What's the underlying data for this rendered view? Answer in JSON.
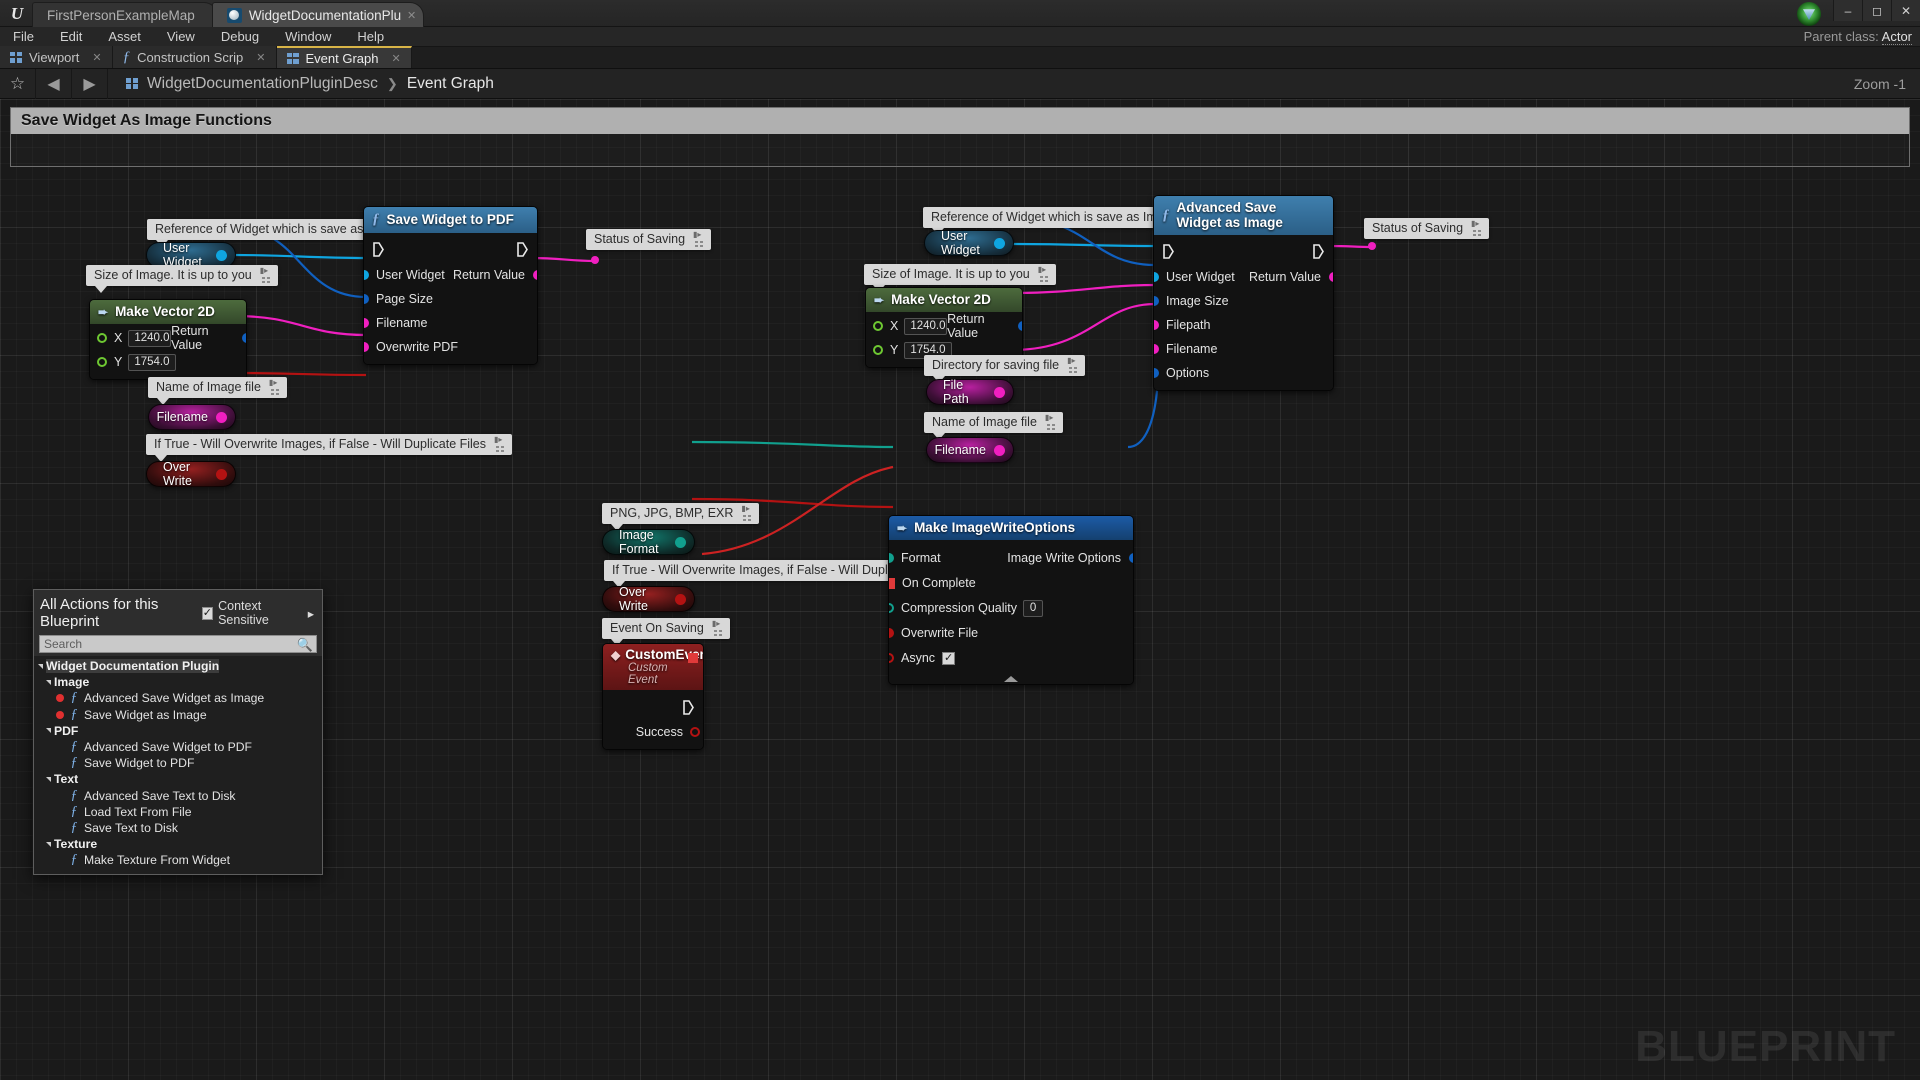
{
  "app": {
    "logo": "ue-logo",
    "window_tabs": [
      {
        "label": "FirstPersonExampleMap",
        "active": false
      },
      {
        "label": "WidgetDocumentationPlu",
        "active": true
      }
    ],
    "window_controls": {
      "minimize": "–",
      "maximize": "❐",
      "close": "✕"
    }
  },
  "menubar": {
    "items": [
      "File",
      "Edit",
      "Asset",
      "View",
      "Debug",
      "Window",
      "Help"
    ]
  },
  "parent_class": {
    "label": "Parent class:",
    "value": "Actor"
  },
  "doctabs": [
    {
      "label": "Viewport",
      "icon": "viewport-icon",
      "active": false,
      "closeable": true
    },
    {
      "label": "Construction Scrip",
      "icon": "function-icon",
      "active": false,
      "closeable": true
    },
    {
      "label": "Event Graph",
      "icon": "graph-icon",
      "active": true,
      "closeable": true
    }
  ],
  "breadcrumb": {
    "star": "☆",
    "back": "◀",
    "forward": "▶",
    "root": "WidgetDocumentationPluginDesc",
    "separator": "❯",
    "current": "Event Graph"
  },
  "zoom": "Zoom -1",
  "comment_frame": {
    "title": "Save Widget As Image Functions"
  },
  "watermark": "BLUEPRINT",
  "bubbles": [
    {
      "id": "b1",
      "text": "Reference of Widget which is save as Image"
    },
    {
      "id": "b2",
      "text": "Size of Image. It is up to you"
    },
    {
      "id": "b3",
      "text": "Name of Image file"
    },
    {
      "id": "b4",
      "text": "If True - Will Overwrite Images, if False - Will Duplicate Files"
    },
    {
      "id": "b5",
      "text": "Reference of Widget which is save as Image"
    },
    {
      "id": "b6",
      "text": "Size of Image. It is up to you"
    },
    {
      "id": "b7",
      "text": "Directory for saving file"
    },
    {
      "id": "b8",
      "text": "Name of Image file"
    },
    {
      "id": "b9",
      "text": "PNG, JPG, BMP, EXR"
    },
    {
      "id": "b10",
      "text": "If True - Will Overwrite Images, if False - Will Duplicate Files"
    },
    {
      "id": "b11",
      "text": "Event On Saving"
    },
    {
      "id": "b12",
      "text": "Status of Saving"
    },
    {
      "id": "b13",
      "text": "Status of Saving"
    }
  ],
  "pills": [
    {
      "id": "p1",
      "label": "User Widget",
      "color": "blue"
    },
    {
      "id": "p2",
      "label": "Filename",
      "color": "pink"
    },
    {
      "id": "p3",
      "label": "Over Write",
      "color": "red"
    },
    {
      "id": "p4",
      "label": "User Widget",
      "color": "blue"
    },
    {
      "id": "p5",
      "label": "File Path",
      "color": "pink"
    },
    {
      "id": "p6",
      "label": "Filename",
      "color": "pink"
    },
    {
      "id": "p7",
      "label": "Image Format",
      "color": "teal"
    },
    {
      "id": "p8",
      "label": "Over Write",
      "color": "red"
    }
  ],
  "nodes": {
    "save_widget_pdf": {
      "title": "Save Widget to PDF",
      "inputs": [
        "User Widget",
        "Page Size",
        "Filename",
        "Overwrite PDF"
      ],
      "outputs": [
        "Return Value"
      ]
    },
    "make_vector_2d_a": {
      "title": "Make Vector 2D",
      "x_label": "X",
      "x_value": "1240.0",
      "y_label": "Y",
      "y_value": "1754.0",
      "output": "Return Value"
    },
    "advanced_save_image": {
      "title": "Advanced Save Widget as Image",
      "inputs": [
        "User Widget",
        "Image Size",
        "Filepath",
        "Filename",
        "Options"
      ],
      "outputs": [
        "Return Value"
      ]
    },
    "make_vector_2d_b": {
      "title": "Make Vector 2D",
      "x_label": "X",
      "x_value": "1240.0",
      "y_label": "Y",
      "y_value": "1754.0",
      "output": "Return Value"
    },
    "make_image_write_options": {
      "title": "Make ImageWriteOptions",
      "inputs": [
        {
          "label": "Format",
          "value": null
        },
        {
          "label": "On Complete",
          "value": null
        },
        {
          "label": "Compression Quality",
          "value": "0"
        },
        {
          "label": "Overwrite File",
          "value": null
        },
        {
          "label": "Async",
          "value": "checked"
        }
      ],
      "outputs": [
        "Image Write Options"
      ]
    },
    "custom_event": {
      "title": "CustomEvent",
      "subtitle": "Custom Event",
      "outputs": [
        "Success"
      ]
    }
  },
  "actions_panel": {
    "title": "All Actions for this Blueprint",
    "context_sensitive": "Context Sensitive",
    "context_checked": true,
    "context_arrow": "▸",
    "search_placeholder": "Search",
    "search_value": "",
    "search_icon": "search-icon",
    "tree": [
      {
        "type": "category",
        "label": "Widget Documentation Plugin",
        "depth": 0,
        "selected": true
      },
      {
        "type": "category",
        "label": "Image",
        "depth": 1
      },
      {
        "type": "action",
        "label": "Advanced Save Widget as Image",
        "depth": 2,
        "dot": true
      },
      {
        "type": "action",
        "label": "Save Widget as Image",
        "depth": 2,
        "dot": true
      },
      {
        "type": "category",
        "label": "PDF",
        "depth": 1
      },
      {
        "type": "action",
        "label": "Advanced Save Widget to PDF",
        "depth": 2,
        "dot": false
      },
      {
        "type": "action",
        "label": "Save Widget to PDF",
        "depth": 2,
        "dot": false
      },
      {
        "type": "category",
        "label": "Text",
        "depth": 1
      },
      {
        "type": "action",
        "label": "Advanced Save Text to Disk",
        "depth": 2,
        "dot": false
      },
      {
        "type": "action",
        "label": "Load Text From File",
        "depth": 2,
        "dot": false
      },
      {
        "type": "action",
        "label": "Save Text to Disk",
        "depth": 2,
        "dot": false
      },
      {
        "type": "category",
        "label": "Texture",
        "depth": 1
      },
      {
        "type": "action",
        "label": "Make Texture From Widget",
        "depth": 2,
        "dot": false
      }
    ]
  },
  "colors": {
    "object_blue": "#0fa5e0",
    "struct_blue": "#1060c0",
    "string_pink": "#f01fc0",
    "bool_red": "#b41212",
    "enum_teal": "#11a08e",
    "float_green": "#6ec832",
    "exec_white": "#e9e9e9",
    "tab_accent": "#d8b447"
  }
}
